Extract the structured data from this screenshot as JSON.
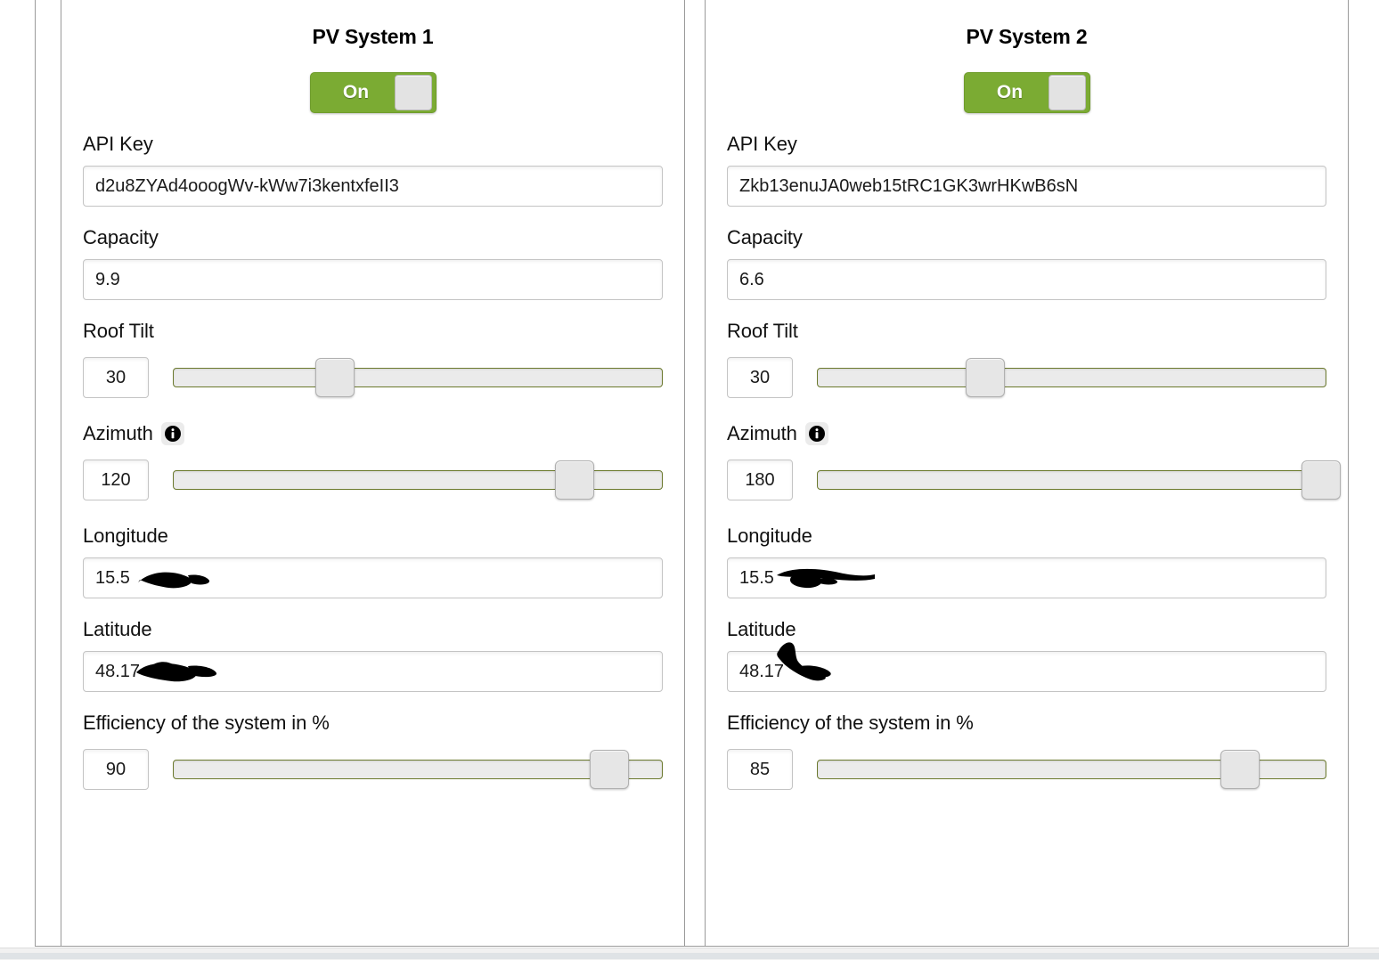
{
  "systems": [
    {
      "title": "PV System 1",
      "toggle": {
        "label": "On",
        "state": "on"
      },
      "api_key": {
        "label": "API Key",
        "value": "d2u8ZYAd4ooogWv-kWw7i3kentxfeII3"
      },
      "capacity": {
        "label": "Capacity",
        "value": "9.9"
      },
      "roof_tilt": {
        "label": "Roof Tilt",
        "value": "30",
        "min": 0,
        "max": 90,
        "percent": 33
      },
      "azimuth": {
        "label": "Azimuth",
        "info_icon": "info-icon",
        "value": "120",
        "min": 0,
        "max": 180,
        "percent": 82
      },
      "longitude": {
        "label": "Longitude",
        "value": "15.5",
        "redacted": true
      },
      "latitude": {
        "label": "Latitude",
        "value": "48.17",
        "redacted": true
      },
      "efficiency": {
        "label": "Efficiency of the system in %",
        "value": "90",
        "min": 0,
        "max": 100,
        "percent": 89
      }
    },
    {
      "title": "PV System 2",
      "toggle": {
        "label": "On",
        "state": "on"
      },
      "api_key": {
        "label": "API Key",
        "value": "Zkb13enuJA0web15tRC1GK3wrHKwB6sN"
      },
      "capacity": {
        "label": "Capacity",
        "value": "6.6"
      },
      "roof_tilt": {
        "label": "Roof Tilt",
        "value": "30",
        "min": 0,
        "max": 90,
        "percent": 33
      },
      "azimuth": {
        "label": "Azimuth",
        "info_icon": "info-icon",
        "value": "180",
        "min": 0,
        "max": 180,
        "percent": 99
      },
      "longitude": {
        "label": "Longitude",
        "value": "15.5",
        "redacted": true
      },
      "latitude": {
        "label": "Latitude",
        "value": "48.17",
        "redacted": true
      },
      "efficiency": {
        "label": "Efficiency of the system in %",
        "value": "85",
        "min": 0,
        "max": 100,
        "percent": 83
      }
    }
  ],
  "colors": {
    "toggle_on_green": "#7BAB33",
    "slider_border_green": "#6C7A2E",
    "track_fill": "#EBEBEB",
    "handle": "#E6E6E6",
    "text": "#111111",
    "frame_line": "#9A9A9A"
  }
}
